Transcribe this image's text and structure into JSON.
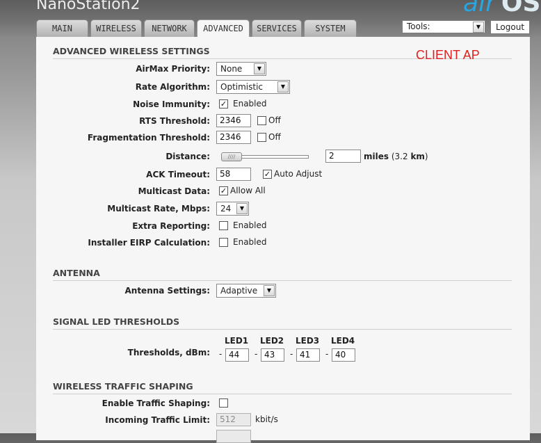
{
  "brand": "NanoStation2",
  "logo": {
    "air": "air",
    "os": "OS"
  },
  "tabs": [
    {
      "label": "MAIN"
    },
    {
      "label": "WIRELESS"
    },
    {
      "label": "NETWORK"
    },
    {
      "label": "ADVANCED",
      "active": true
    },
    {
      "label": "SERVICES"
    },
    {
      "label": "SYSTEM"
    }
  ],
  "tools": {
    "label": "Tools:"
  },
  "logout": "Logout",
  "annotation": "CLIENT AP",
  "advanced_wireless": {
    "title": "ADVANCED WIRELESS SETTINGS",
    "airmax_priority": {
      "label": "AirMax Priority:",
      "value": "None"
    },
    "rate_algorithm": {
      "label": "Rate Algorithm:",
      "value": "Optimistic"
    },
    "noise_immunity": {
      "label": "Noise Immunity:",
      "checked": true,
      "text": "Enabled"
    },
    "rts_threshold": {
      "label": "RTS Threshold:",
      "value": "2346",
      "off_text": "Off",
      "off_checked": false
    },
    "fragmentation_threshold": {
      "label": "Fragmentation Threshold:",
      "value": "2346",
      "off_text": "Off",
      "off_checked": false
    },
    "distance": {
      "label": "Distance:",
      "value": "2",
      "unit": "miles",
      "km": "(3.2 km)",
      "km_value": "3.2",
      "km_unit": "km"
    },
    "ack_timeout": {
      "label": "ACK Timeout:",
      "value": "58",
      "auto_text": "Auto Adjust",
      "auto_checked": true
    },
    "multicast_data": {
      "label": "Multicast Data:",
      "checked": true,
      "text": "Allow All"
    },
    "multicast_rate": {
      "label": "Multicast Rate, Mbps:",
      "value": "24"
    },
    "extra_reporting": {
      "label": "Extra Reporting:",
      "checked": false,
      "text": "Enabled"
    },
    "installer_eirp": {
      "label": "Installer EIRP Calculation:",
      "checked": false,
      "text": "Enabled"
    }
  },
  "antenna": {
    "title": "ANTENNA",
    "settings": {
      "label": "Antenna Settings:",
      "value": "Adaptive"
    }
  },
  "signal_led": {
    "title": "SIGNAL LED THRESHOLDS",
    "label": "Thresholds, dBm:",
    "leds": [
      {
        "name": "LED1",
        "value": "44"
      },
      {
        "name": "LED2",
        "value": "43"
      },
      {
        "name": "LED3",
        "value": "41"
      },
      {
        "name": "LED4",
        "value": "40"
      }
    ]
  },
  "traffic_shaping": {
    "title": "WIRELESS TRAFFIC SHAPING",
    "enable": {
      "label": "Enable Traffic Shaping:",
      "checked": false
    },
    "incoming_limit": {
      "label": "Incoming Traffic Limit:",
      "value": "512",
      "unit": "kbit/s"
    }
  }
}
